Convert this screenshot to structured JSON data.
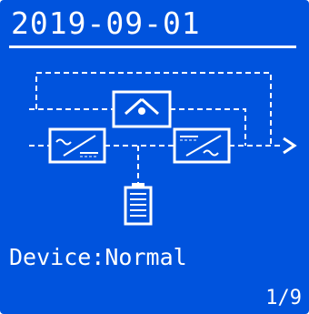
{
  "header": {
    "date": "2019-09-01"
  },
  "status": {
    "device_text": "Device:Normal"
  },
  "footer": {
    "page_indicator": "1/9"
  },
  "colors": {
    "background": "#0053dd",
    "foreground": "#ffffff"
  },
  "diagram": {
    "icons": [
      "bypass-icon",
      "rectifier-icon",
      "inverter-icon",
      "battery-icon",
      "output-arrow-icon"
    ]
  }
}
